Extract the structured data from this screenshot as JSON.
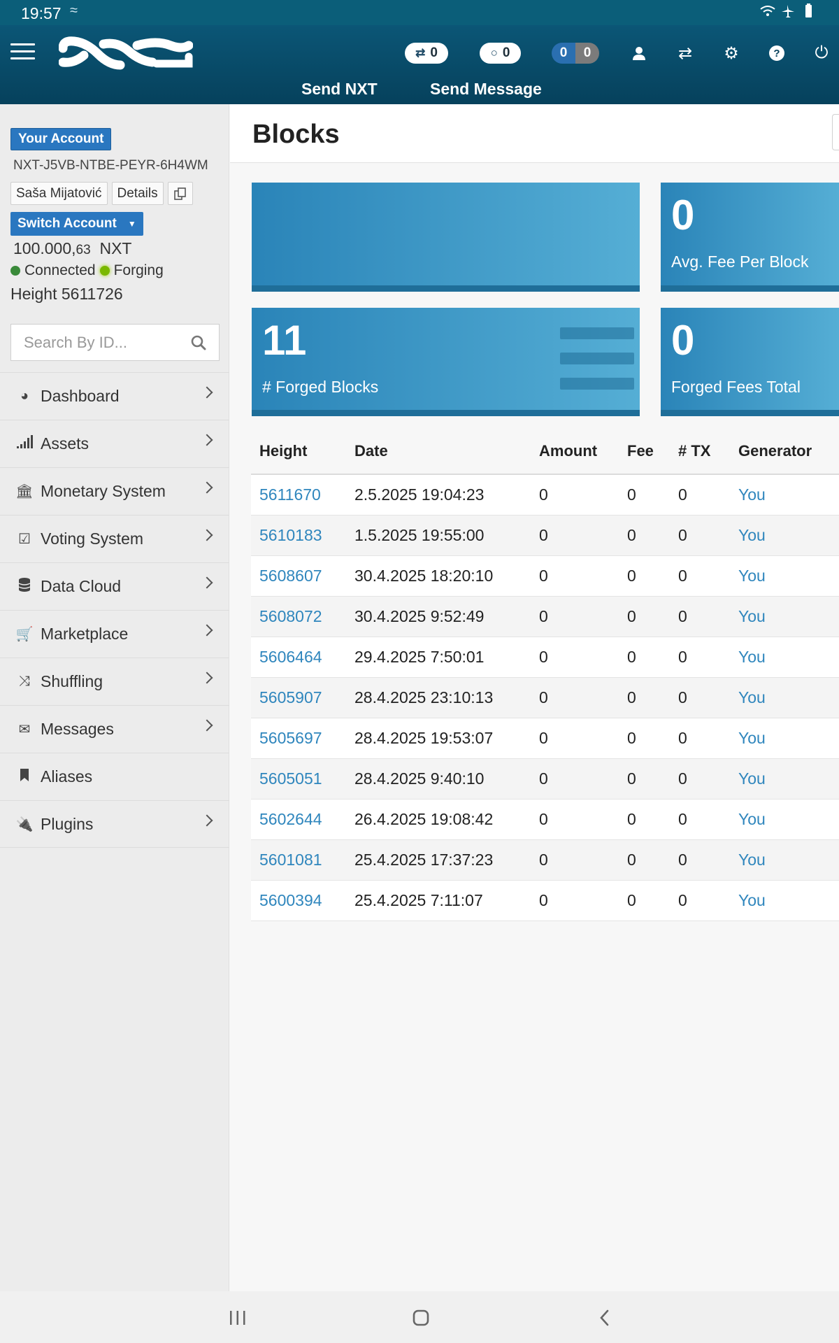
{
  "status_bar": {
    "time": "19:57",
    "left_icon": "wave-icon",
    "right_icons": "wifi, airplane, battery"
  },
  "header": {
    "pill_shuffle_count": "0",
    "pill_circle_count": "0",
    "pill_blue_count": "0",
    "pill_gray_count": "0",
    "link_send_nxt": "Send NXT",
    "link_send_message": "Send Message"
  },
  "account": {
    "badge": "Your Account",
    "id": "NXT-J5VB-NTBE-PEYR-6H4WM",
    "name": "Saša Mijatović",
    "details_label": "Details",
    "switch_label": "Switch Account",
    "balance_int": "100.000,",
    "balance_dec": "63",
    "balance_unit": "NXT",
    "connected_label": "Connected",
    "forging_label": "Forging",
    "height_label": "Height 5611726"
  },
  "search": {
    "placeholder": "Search By ID..."
  },
  "menu": [
    {
      "label": "Dashboard",
      "icon": "dashboard-icon"
    },
    {
      "label": "Assets",
      "icon": "signal-bars-icon"
    },
    {
      "label": "Monetary System",
      "icon": "bank-icon"
    },
    {
      "label": "Voting System",
      "icon": "checkbox-icon"
    },
    {
      "label": "Data Cloud",
      "icon": "database-icon"
    },
    {
      "label": "Marketplace",
      "icon": "cart-icon"
    },
    {
      "label": "Shuffling",
      "icon": "shuffle-icon"
    },
    {
      "label": "Messages",
      "icon": "envelope-icon"
    },
    {
      "label": "Aliases",
      "icon": "bookmark-icon"
    },
    {
      "label": "Plugins",
      "icon": "plug-icon"
    }
  ],
  "page": {
    "title": "Blocks"
  },
  "tiles": {
    "avg_fee_value": "0",
    "avg_fee_label": "Avg. Fee Per Block",
    "forged_blocks_value": "11",
    "forged_blocks_label": "# Forged Blocks",
    "forged_fees_value": "0",
    "forged_fees_label": "Forged Fees Total"
  },
  "table": {
    "headers": [
      "Height",
      "Date",
      "Amount",
      "Fee",
      "# TX",
      "Generator"
    ],
    "rows": [
      [
        "5611670",
        "2.5.2025 19:04:23",
        "0",
        "0",
        "0",
        "You"
      ],
      [
        "5610183",
        "1.5.2025 19:55:00",
        "0",
        "0",
        "0",
        "You"
      ],
      [
        "5608607",
        "30.4.2025 18:20:10",
        "0",
        "0",
        "0",
        "You"
      ],
      [
        "5608072",
        "30.4.2025 9:52:49",
        "0",
        "0",
        "0",
        "You"
      ],
      [
        "5606464",
        "29.4.2025 7:50:01",
        "0",
        "0",
        "0",
        "You"
      ],
      [
        "5605907",
        "28.4.2025 23:10:13",
        "0",
        "0",
        "0",
        "You"
      ],
      [
        "5605697",
        "28.4.2025 19:53:07",
        "0",
        "0",
        "0",
        "You"
      ],
      [
        "5605051",
        "28.4.2025 9:40:10",
        "0",
        "0",
        "0",
        "You"
      ],
      [
        "5602644",
        "26.4.2025 19:08:42",
        "0",
        "0",
        "0",
        "You"
      ],
      [
        "5601081",
        "25.4.2025 17:37:23",
        "0",
        "0",
        "0",
        "You"
      ],
      [
        "5600394",
        "25.4.2025 7:11:07",
        "0",
        "0",
        "0",
        "You"
      ]
    ]
  },
  "colors": {
    "header": "#0b5676",
    "accent": "#2a77c0",
    "link": "#2f86bd",
    "tile": "#55aed5"
  }
}
